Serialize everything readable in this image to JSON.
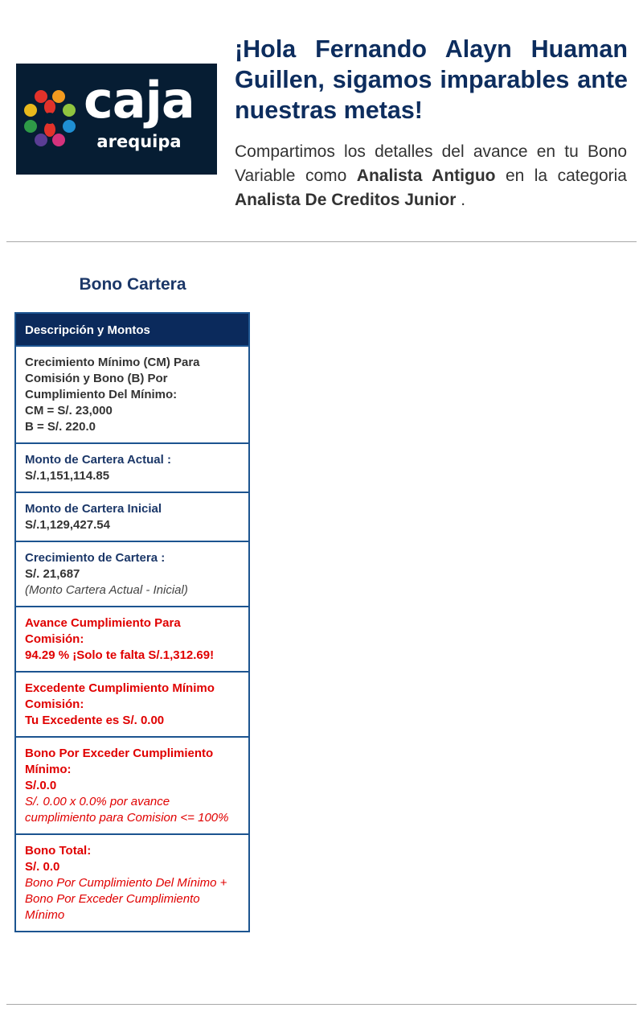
{
  "logo": {
    "brand": "caja",
    "sub": "arequipa",
    "icon": "caja-arequipa-flower-icon"
  },
  "header": {
    "greeting": "¡Hola Fernando Alayn Huaman Guillen, sigamos imparables ante nuestras metas!",
    "intro_pre": "Compartimos los detalles del avance en tu Bono Variable como ",
    "role": "Analista Antiguo",
    "intro_mid": " en la categoria ",
    "category": "Analista De Creditos Junior",
    "intro_end": " ."
  },
  "section": {
    "title": "Bono Cartera",
    "table_header": "Descripción y Montos",
    "rows": [
      {
        "label": "Crecimiento Mínimo (CM) Para Comisión y Bono (B) Por Cumplimiento Del Mínimo:",
        "line1": "CM = S/. 23,000",
        "line2": "B = S/. 220.0"
      },
      {
        "label": "Monto de Cartera Actual :",
        "value": "S/.1,151,114.85"
      },
      {
        "label": "Monto de Cartera Inicial",
        "value": "S/.1,129,427.54"
      },
      {
        "label": "Crecimiento de Cartera :",
        "value": "S/. 21,687",
        "note": "(Monto Cartera Actual - Inicial)"
      },
      {
        "label": "Avance Cumplimiento Para Comisión:",
        "value": "94.29 % ¡Solo te falta S/.1,312.69!"
      },
      {
        "label": "Excedente Cumplimiento Mínimo Comisión:",
        "value": "Tu Excedente es S/. 0.00"
      },
      {
        "label": "Bono Por Exceder Cumplimiento Mínimo:",
        "value": "S/.0.0",
        "note": "S/. 0.00 x 0.0% por avance cumplimiento para Comision <= 100%"
      },
      {
        "label": "Bono Total:",
        "value": "S/. 0.0",
        "note": "Bono Por Cumplimiento Del Mínimo + Bono Por Exceder Cumplimiento Mínimo"
      }
    ]
  },
  "colors": {
    "navy": "#0d2d5e",
    "header_bg": "#0b2a5c",
    "border": "#1c5490",
    "red": "#e00000",
    "logo_bg": "#061d33"
  }
}
